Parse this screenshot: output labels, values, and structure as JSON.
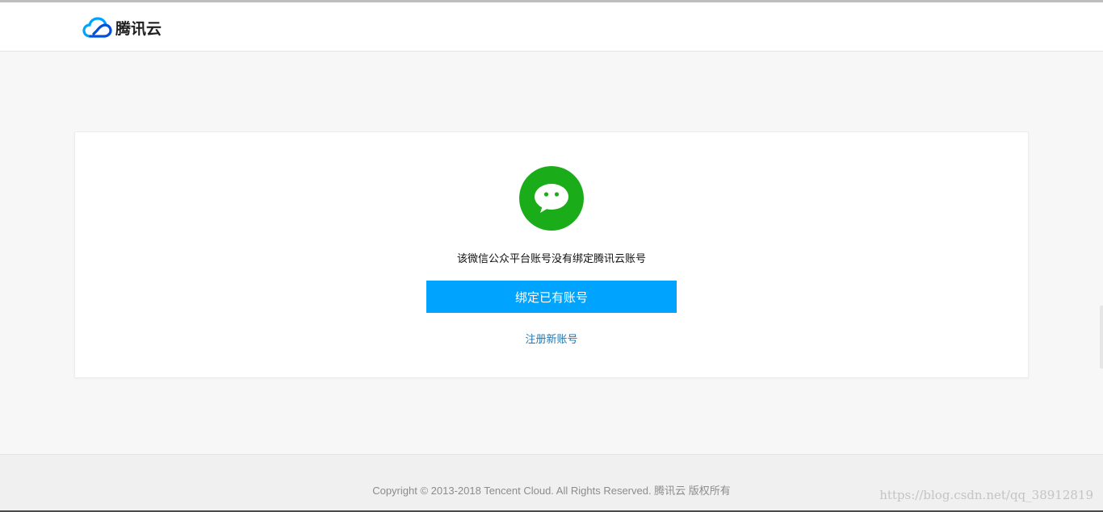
{
  "header": {
    "brand_name": "腾讯云",
    "logo_icon": "tencent-cloud-icon",
    "logo_colors": [
      "#00a4ff",
      "#0052d9"
    ]
  },
  "main": {
    "status_icon": "wechat-icon",
    "status_icon_color": "#1aad19",
    "message": "该微信公众平台账号没有绑定腾讯云账号",
    "bind_button_label": "绑定已有账号",
    "bind_button_color": "#00a4ff",
    "register_link_label": "注册新账号"
  },
  "footer": {
    "copyright": "Copyright © 2013-2018 Tencent Cloud. All Rights Reserved. 腾讯云 版权所有",
    "watermark": "https://blog.csdn.net/qq_38912819"
  }
}
